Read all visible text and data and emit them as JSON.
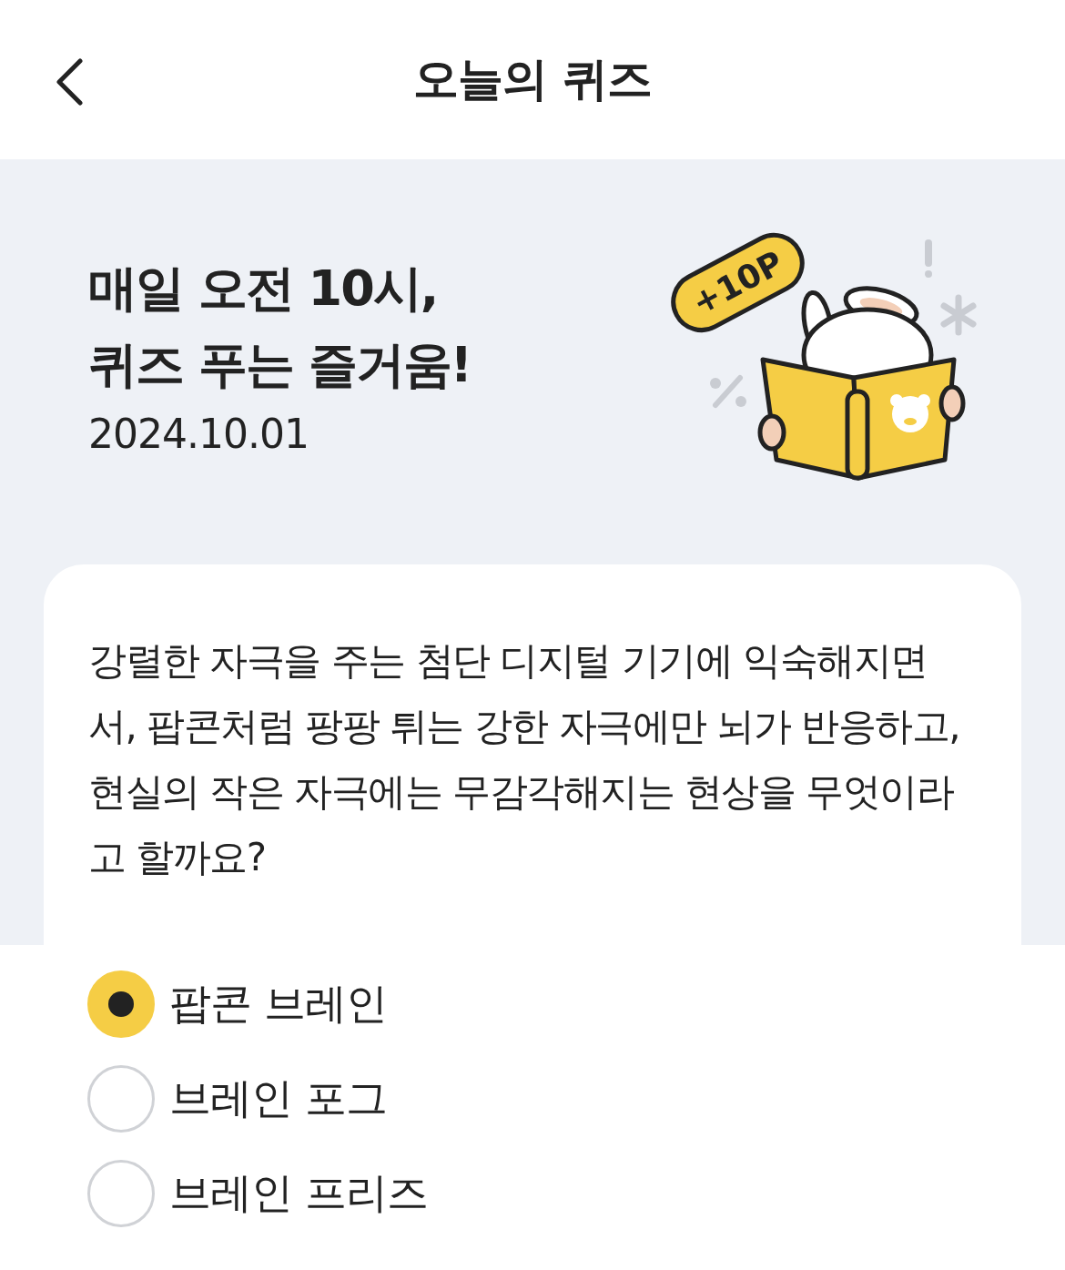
{
  "header": {
    "title": "오늘의 퀴즈"
  },
  "hero": {
    "headline_lines": [
      "매일 오전 10시,",
      "퀴즈 푸는 즐거움!"
    ],
    "date": "2024.10.01",
    "badge": "+10P"
  },
  "question": "강렬한 자극을 주는 첨단 디지털 기기에 익숙해지면서, 팝콘처럼 팡팡 튀는 강한 자극에만 뇌가 반응하고, 현실의 작은 자극에는 무감각해지는 현상을 무엇이라고 할까요?",
  "options": [
    {
      "label": "팝콘 브레인",
      "selected": true
    },
    {
      "label": "브레인 포그",
      "selected": false
    },
    {
      "label": "브레인 프리즈",
      "selected": false
    }
  ]
}
